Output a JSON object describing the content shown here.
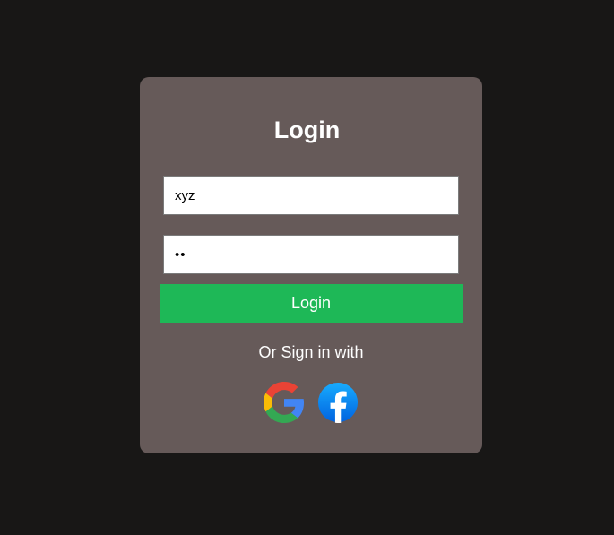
{
  "login_form": {
    "title": "Login",
    "username_value": "xyz",
    "password_value": "••",
    "login_button_label": "Login",
    "alt_signin_text": "Or Sign in with"
  },
  "social_icons": [
    "google-icon",
    "facebook-icon"
  ],
  "colors": {
    "page_background": "#181716",
    "card_background": "#665a59",
    "login_button": "#1eb857",
    "facebook_blue": "#1877f2"
  }
}
